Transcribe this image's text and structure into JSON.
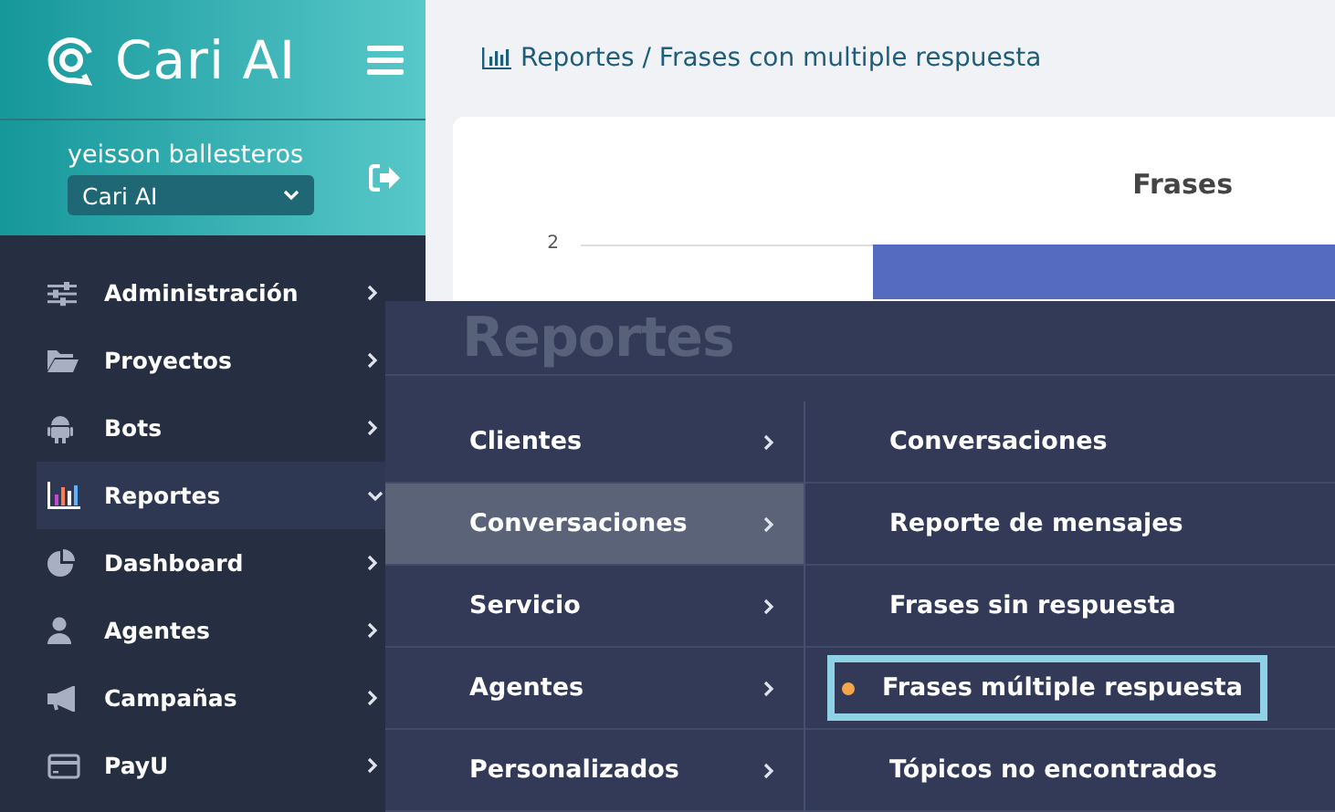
{
  "brand": {
    "name": "Cari AI"
  },
  "user": {
    "name": "yeisson ballesteros",
    "workspace": "Cari AI"
  },
  "sidebar": {
    "items": [
      {
        "label": "Administración",
        "selected": false,
        "expanded": false
      },
      {
        "label": "Proyectos",
        "selected": false,
        "expanded": false
      },
      {
        "label": "Bots",
        "selected": false,
        "expanded": false
      },
      {
        "label": "Reportes",
        "selected": true,
        "expanded": true
      },
      {
        "label": "Dashboard",
        "selected": false,
        "expanded": false
      },
      {
        "label": "Agentes",
        "selected": false,
        "expanded": false
      },
      {
        "label": "Campañas",
        "selected": false,
        "expanded": false
      },
      {
        "label": "PayU",
        "selected": false,
        "expanded": false
      }
    ]
  },
  "breadcrumb": "Reportes / Frases con multiple respuesta",
  "chart": {
    "title": "Frases",
    "tick_label": "2"
  },
  "reports_menu": {
    "title": "Reportes",
    "categories": [
      {
        "label": "Clientes",
        "selected": false
      },
      {
        "label": "Conversaciones",
        "selected": true
      },
      {
        "label": "Servicio",
        "selected": false
      },
      {
        "label": "Agentes",
        "selected": false
      },
      {
        "label": "Personalizados",
        "selected": false
      }
    ],
    "reports": [
      {
        "label": "Conversaciones",
        "selected": false
      },
      {
        "label": "Reporte de mensajes",
        "selected": false
      },
      {
        "label": "Frases sin respuesta",
        "selected": false
      },
      {
        "label": "Frases múltiple respuesta",
        "selected": true
      },
      {
        "label": "Tópicos no encontrados",
        "selected": false
      }
    ]
  }
}
